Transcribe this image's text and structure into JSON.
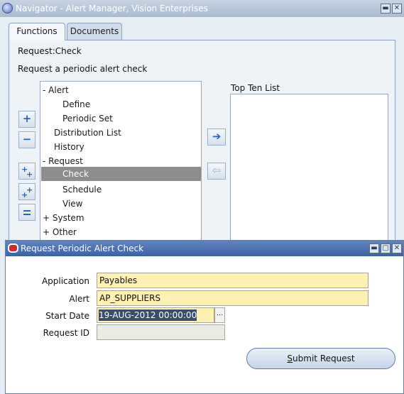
{
  "navigator": {
    "title": "Navigator - Alert Manager, Vision Enterprises",
    "tabs": [
      {
        "label": "Functions",
        "active": true
      },
      {
        "label": "Documents",
        "active": false
      }
    ],
    "context_label": "Request:Check",
    "description": "Request a periodic alert check",
    "tree": [
      {
        "label": "-  Alert"
      },
      {
        "label": "Define"
      },
      {
        "label": "Periodic Set"
      },
      {
        "label": "Distribution List"
      },
      {
        "label": "History"
      },
      {
        "label": "-  Request"
      },
      {
        "label": "Check",
        "selected": true
      },
      {
        "label": "Schedule"
      },
      {
        "label": "View"
      },
      {
        "label": "+  System"
      },
      {
        "label": "+  Other"
      }
    ],
    "top_ten_label": "Top Ten List",
    "side_buttons": [
      "expand",
      "collapse",
      "expand-all",
      "expand-branch",
      "collapse-all"
    ],
    "move_buttons": [
      "add-to-top-ten",
      "remove-from-top-ten"
    ]
  },
  "dialog": {
    "title": "Request Periodic Alert Check",
    "fields": {
      "application": {
        "label": "Application",
        "value": "Payables"
      },
      "alert": {
        "label": "Alert",
        "value": "AP_SUPPLIERS"
      },
      "start_date": {
        "label": "Start Date",
        "value": "19-AUG-2012 00:00:00"
      },
      "request_id": {
        "label": "Request ID",
        "value": ""
      }
    },
    "lov_glyph": "...",
    "submit": {
      "accesskey": "S",
      "rest": "ubmit Request"
    }
  },
  "glyphs": {
    "minimize": "▬",
    "maximize": "▢",
    "close": "✕",
    "plus": "+",
    "minus": "−",
    "arrow_right": "➔",
    "arrow_left": "⇦"
  },
  "colors": {
    "required_field_bg": "#fef2b2",
    "selected_row_bg": "#8d8d8d",
    "dialog_title_bg": "#3d63a6"
  }
}
